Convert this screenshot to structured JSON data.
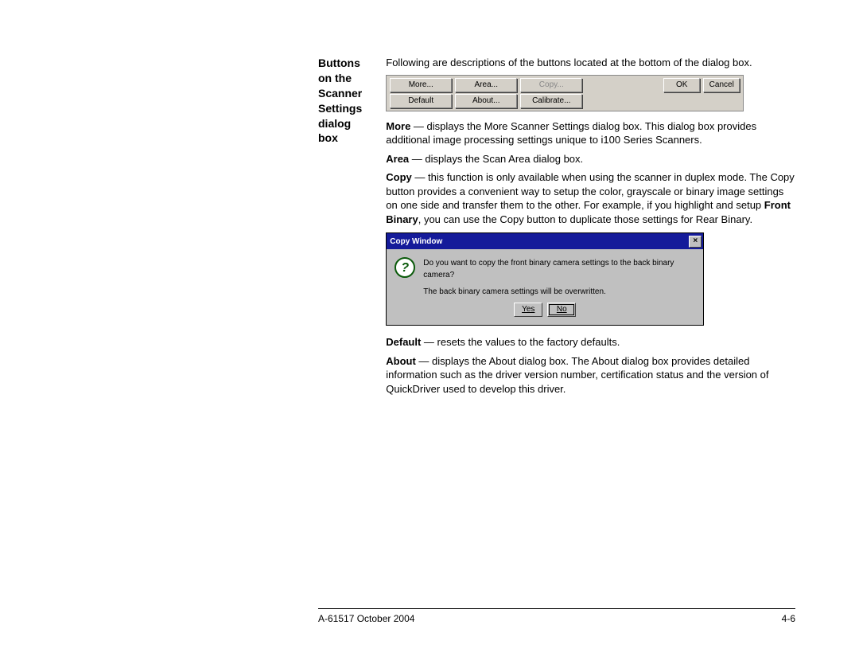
{
  "heading": "Buttons on the Scanner Settings dialog box",
  "intro": "Following are descriptions of the buttons located at the bottom of the dialog box.",
  "button_bar": {
    "row1": [
      "More...",
      "Area...",
      "Copy...",
      "OK",
      "Cancel"
    ],
    "row1_disabled_index": 2,
    "row2": [
      "Default",
      "About...",
      "Calibrate..."
    ]
  },
  "defs": {
    "more_b": "More",
    "more_t": " — displays the More Scanner Settings dialog box. This dialog box provides additional image processing settings unique to i100 Series Scanners.",
    "area_b": "Area",
    "area_t": " — displays the Scan Area dialog box.",
    "copy_b": "Copy",
    "copy_t1": " — this function is only available when using the scanner in duplex mode. The Copy button provides a convenient way to setup the color, grayscale or binary image settings on one side and transfer them to the other. For example, if you highlight and setup ",
    "copy_em": "Front Binary",
    "copy_t2": ", you can use the Copy button to duplicate those settings for Rear Binary.",
    "default_b": "Default",
    "default_t": " — resets the values to the factory defaults.",
    "about_b": "About",
    "about_t": " — displays the About dialog box. The About dialog box provides detailed information such as the driver version number, certification status and the version of QuickDriver used to develop this driver."
  },
  "copy_window": {
    "title": "Copy Window",
    "line1": "Do you want to copy the front binary camera settings to the back binary camera?",
    "line2": "The back binary camera settings will be overwritten.",
    "yes": "Yes",
    "no": "No"
  },
  "footer": {
    "left": "A-61517 October 2004",
    "right": "4-6"
  }
}
